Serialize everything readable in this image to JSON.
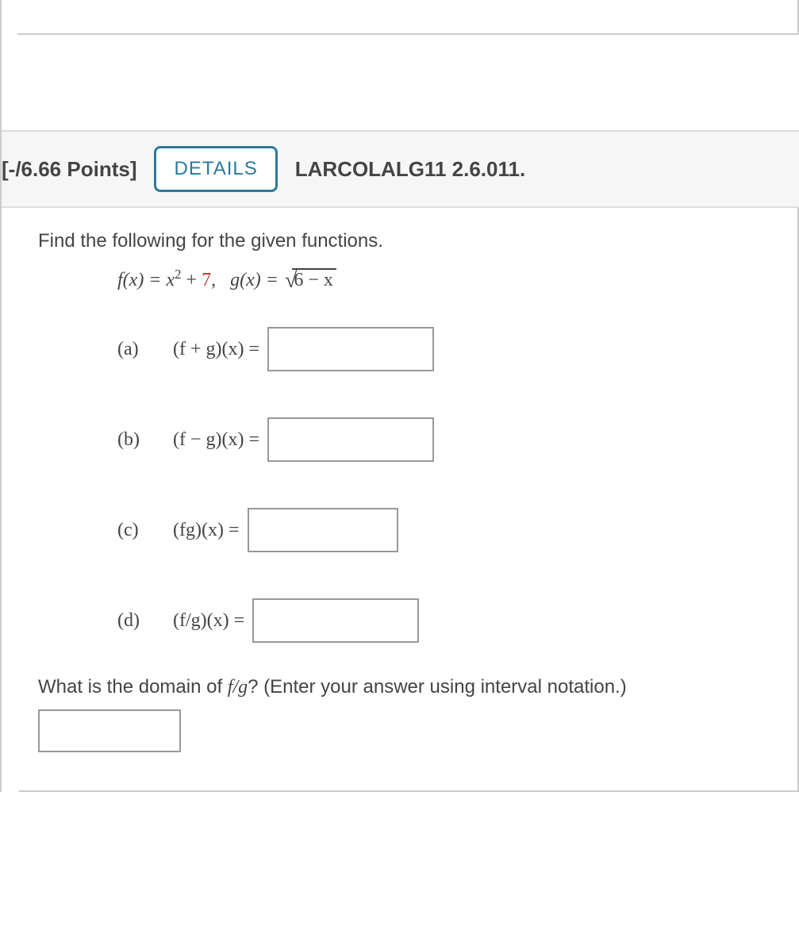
{
  "header": {
    "points": "[-/6.66 Points]",
    "details_label": "DETAILS",
    "reference": "LARCOLALG11 2.6.011."
  },
  "question": {
    "prompt": "Find the following for the given functions.",
    "functions": {
      "f_lhs": "f(x) = x",
      "f_exp": "2",
      "f_plus": " + ",
      "f_const": "7",
      "f_comma": ",   ",
      "g_lhs": "g(x) = ",
      "g_rad_inner": "6 − x"
    },
    "parts": [
      {
        "label": "(a)",
        "expr": "(f + g)(x) ="
      },
      {
        "label": "(b)",
        "expr": "(f − g)(x) ="
      },
      {
        "label": "(c)",
        "expr": "(fg)(x) ="
      },
      {
        "label": "(d)",
        "expr": "(f/g)(x) ="
      }
    ],
    "domain_prompt_pre": "What is the domain of ",
    "domain_fg": "f/g",
    "domain_prompt_post": "? (Enter your answer using interval notation.)"
  }
}
